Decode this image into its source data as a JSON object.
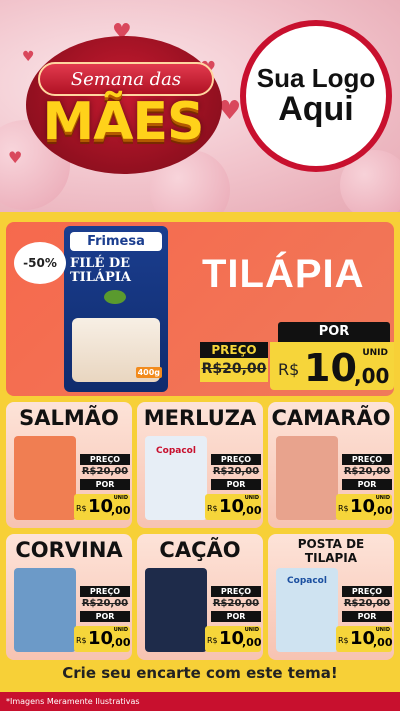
{
  "hero": {
    "ribbon_text": "Semana das",
    "title": "MÃES",
    "logo_line1": "Sua Logo",
    "logo_line2": "Aqui"
  },
  "feature": {
    "discount": "-50%",
    "brand": "Frimesa",
    "package_name": "FILÉ DE TILÁPIA",
    "package_weight": "400g",
    "title": "TILÁPIA",
    "preco_label": "PREÇO",
    "old_price": "R$20,00",
    "por_label": "POR",
    "currency": "R$",
    "price_int": "10",
    "price_cents": ",00",
    "unit": "UNID"
  },
  "products": [
    {
      "title": "SALMÃO",
      "preco_label": "PREÇO",
      "old_price": "R$20,00",
      "por_label": "POR",
      "currency": "R$",
      "price_int": "10",
      "price_cents": ",00",
      "unit": "UNID",
      "color": "#f07e52"
    },
    {
      "title": "MERLUZA",
      "brand": "Copacol",
      "preco_label": "PREÇO",
      "old_price": "R$20,00",
      "por_label": "POR",
      "currency": "R$",
      "price_int": "10",
      "price_cents": ",00",
      "unit": "UNID",
      "color": "#e7eef6"
    },
    {
      "title": "CAMARÃO",
      "preco_label": "PREÇO",
      "old_price": "R$20,00",
      "por_label": "POR",
      "currency": "R$",
      "price_int": "10",
      "price_cents": ",00",
      "unit": "UNID",
      "color": "#e8a38d"
    },
    {
      "title": "CORVINA",
      "preco_label": "PREÇO",
      "old_price": "R$20,00",
      "por_label": "POR",
      "currency": "R$",
      "price_int": "10",
      "price_cents": ",00",
      "unit": "UNID",
      "color": "#6c9ac8"
    },
    {
      "title": "CAÇÃO",
      "preco_label": "PREÇO",
      "old_price": "R$20,00",
      "por_label": "POR",
      "currency": "R$",
      "price_int": "10",
      "price_cents": ",00",
      "unit": "UNID",
      "color": "#1e2b4a"
    },
    {
      "title": "POSTA DE TILAPIA",
      "brand": "Copacol",
      "preco_label": "PREÇO",
      "old_price": "R$20,00",
      "por_label": "POR",
      "currency": "R$",
      "price_int": "10",
      "price_cents": ",00",
      "unit": "UNID",
      "color": "#cfe3f1"
    }
  ],
  "cta": "Crie seu encarte com este tema!",
  "footer": "*Imagens Meramente Ilustrativas"
}
